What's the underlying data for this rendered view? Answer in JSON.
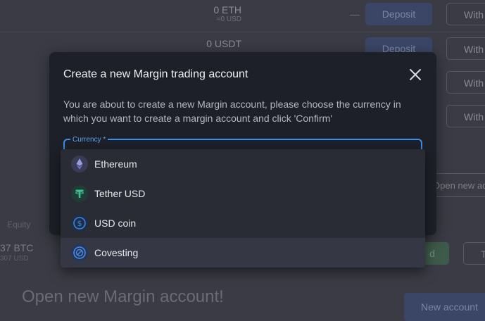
{
  "background": {
    "rows": [
      {
        "amount": "0 ETH",
        "usd": "≈0 USD",
        "dash": "—",
        "deposit": "Deposit",
        "withdraw": "With"
      },
      {
        "amount": "0 USDT",
        "usd": "",
        "dash": "",
        "deposit": "Deposit",
        "withdraw": "With"
      },
      {
        "amount": "",
        "usd": "",
        "dash": "",
        "deposit": "",
        "withdraw": "With"
      },
      {
        "amount": "",
        "usd": "",
        "dash": "",
        "deposit": "",
        "withdraw": "With"
      }
    ],
    "open_new_link": "Open new acco",
    "equity_label": "Equity",
    "btc_amount": "37 BTC",
    "btc_usd": "307 USD",
    "green_button": "d",
    "t_button": "T",
    "heading": "Open new Margin account!",
    "new_account_button": "New account"
  },
  "modal": {
    "title": "Create a new Margin trading account",
    "description": "You are about to create a new Margin account, please choose the currency in which you want to create a margin account and click 'Confirm'",
    "currency_label": "Currency *"
  },
  "dropdown": {
    "options": [
      {
        "label": "Ethereum",
        "icon": "ethereum-icon",
        "color": "#8c8cd9",
        "bg": "#3a3b54"
      },
      {
        "label": "Tether USD",
        "icon": "tether-icon",
        "color": "#26a17b",
        "bg": "#1f3d36"
      },
      {
        "label": "USD coin",
        "icon": "usd-coin-icon",
        "color": "#2775ca",
        "bg": "#1d2e4a"
      },
      {
        "label": "Covesting",
        "icon": "covesting-icon",
        "color": "#3d7bd9",
        "bg": "#22375a"
      }
    ],
    "hovered_index": 3
  },
  "colors": {
    "accent": "#3d8ee8",
    "modal_bg": "#1e2029",
    "page_bg": "#3a3b44"
  }
}
